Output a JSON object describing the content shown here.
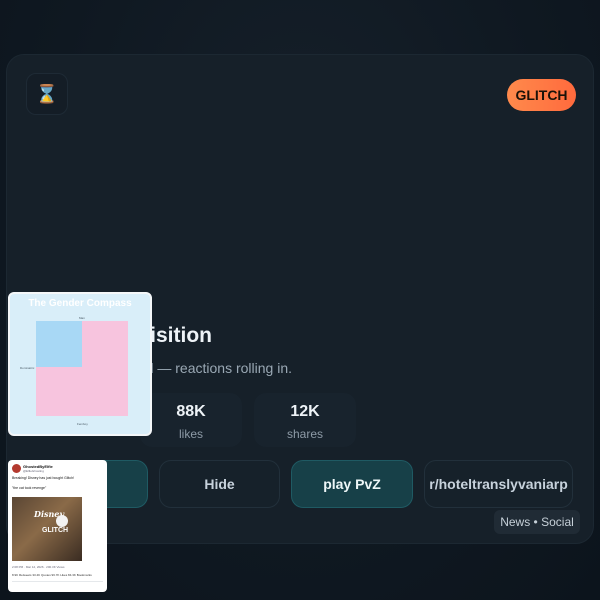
{
  "card": {
    "badge": "GLITCH",
    "title": "uisition",
    "subtitle": "ed — reactions rolling in.",
    "corner_icon": "hourglass-icon",
    "stats": [
      {
        "value": "88K",
        "label": "likes"
      },
      {
        "value": "12K",
        "label": "shares"
      }
    ],
    "buttons": {
      "hide": "Hide",
      "play": "play PvZ",
      "subreddit": "r/hoteltranslyvaniarp"
    },
    "category": "News • Social"
  },
  "thumbnails": {
    "compass": {
      "title": "The Gender Compass",
      "top_label": "Man",
      "left_label": "Dominatrix",
      "bottom_label": "Femboy"
    },
    "tweet": {
      "name": "GhostedByElfie",
      "handle": "@ElfieGhosting",
      "text": "Breaking! Disney has just bought Glitch!",
      "quote": "\"the cat took revenge\"",
      "image_brand": "Disney",
      "image_caption": "GLITCH",
      "meta": "2:08 PM · Mar 12, 2026 · 200.3K Views",
      "stats": "8.9K Retweets  33.4K Quotes  96.7K Likes  84.3K Bookmarks"
    }
  },
  "colors": {
    "background": "#0f1821",
    "card": "#162029",
    "badge_accent": "#ff7a45",
    "teal_button": "#174048"
  }
}
